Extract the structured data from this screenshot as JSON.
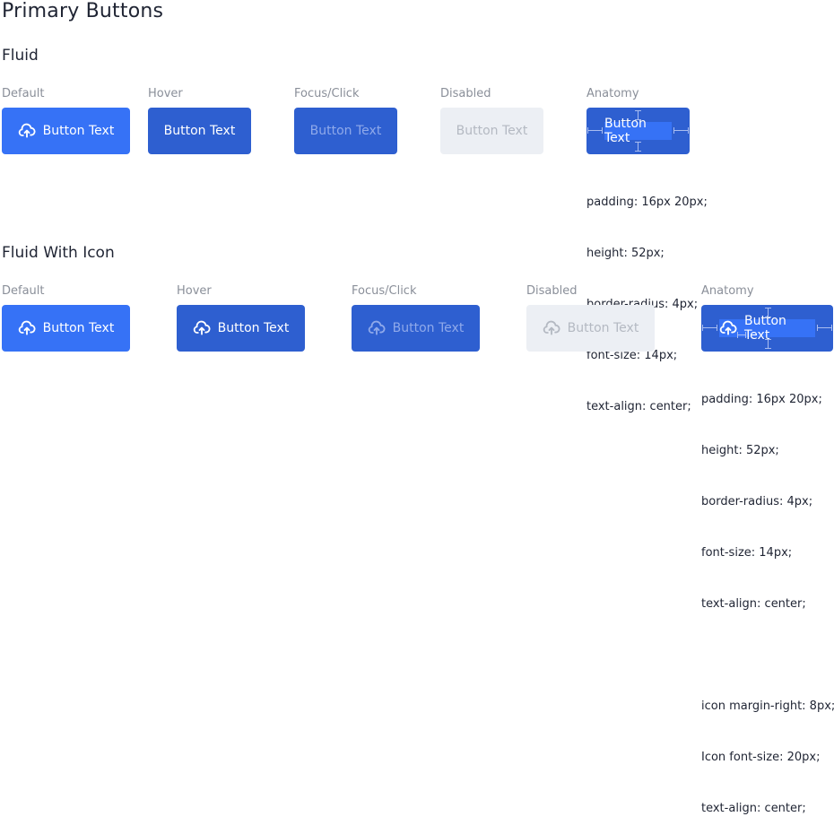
{
  "page": {
    "title": "Primary Buttons"
  },
  "sections": [
    {
      "heading": "Fluid",
      "states": [
        {
          "label": "Default",
          "button_text": "Button Text",
          "icon": "cloud-upload-icon"
        },
        {
          "label": "Hover",
          "button_text": "Button Text"
        },
        {
          "label": "Focus/Click",
          "button_text": "Button Text"
        },
        {
          "label": "Disabled",
          "button_text": "Button Text"
        },
        {
          "label": "Anatomy",
          "button_text": "Button Text"
        }
      ],
      "specs": [
        "padding: 16px 20px;",
        "height: 52px;",
        "border-radius: 4px;",
        "font-size: 14px;",
        "text-align: center;"
      ]
    },
    {
      "heading": "Fluid With Icon",
      "states": [
        {
          "label": "Default",
          "button_text": "Button Text",
          "icon": "cloud-upload-icon"
        },
        {
          "label": "Hover",
          "button_text": "Button Text",
          "icon": "cloud-upload-icon"
        },
        {
          "label": "Focus/Click",
          "button_text": "Button Text",
          "icon": "cloud-upload-icon"
        },
        {
          "label": "Disabled",
          "button_text": "Button Text",
          "icon": "cloud-upload-icon"
        },
        {
          "label": "Anatomy",
          "button_text": "Button Text",
          "icon": "cloud-upload-icon"
        }
      ],
      "specs": [
        "padding: 16px 20px;",
        "height: 52px;",
        "border-radius: 4px;",
        "font-size: 14px;",
        "text-align: center;",
        "",
        "icon margin-right: 8px;",
        "Icon font-size: 20px;",
        "text-align: center;"
      ]
    }
  ],
  "colors": {
    "primary": "#3672f6",
    "primary_hover": "#2e5fd0",
    "focus_text": "#8fa9ea",
    "disabled_bg": "#eceff4",
    "disabled_text": "#b4b9c2"
  }
}
